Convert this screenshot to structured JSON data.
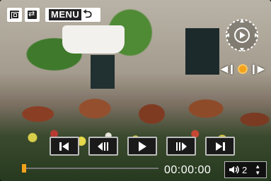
{
  "toolbar": {
    "menu_label": "MENU"
  },
  "playback": {
    "timecode": "00:00:00",
    "progress_fraction": 0.0,
    "volume_level": "2"
  },
  "icons": {
    "left": [
      "grid-view-icon",
      "swap-icon"
    ],
    "transport": [
      "skip-to-start-icon",
      "frame-back-icon",
      "play-icon",
      "frame-forward-icon",
      "skip-to-end-icon"
    ]
  },
  "colors": {
    "accent": "#f2a21d",
    "button_bg": "#1a1a1a",
    "button_border": "#bdbdbd"
  }
}
